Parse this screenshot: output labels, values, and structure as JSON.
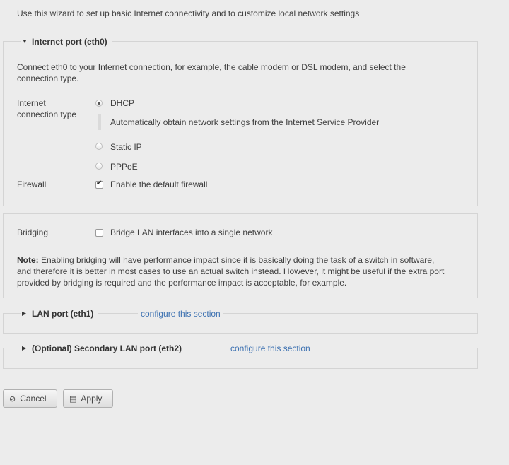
{
  "intro": "Use this wizard to set up basic Internet connectivity and to customize local network settings",
  "internet": {
    "legend": "Internet port (eth0)",
    "description_line1": "Connect eth0 to your Internet connection, for example, the cable modem or DSL modem, and select the",
    "description_line2": "connection type.",
    "conn_label_line1": "Internet",
    "conn_label_line2": "connection type",
    "options": [
      {
        "label": "DHCP",
        "checked": true
      },
      {
        "label": "Static IP",
        "checked": false
      },
      {
        "label": "PPPoE",
        "checked": false
      }
    ],
    "dhcp_hint": "Automatically obtain network settings from the Internet Service Provider",
    "firewall_label": "Firewall",
    "firewall_option": "Enable the default firewall",
    "firewall_checked": true
  },
  "bridging": {
    "label": "Bridging",
    "option": "Bridge LAN interfaces into a single network",
    "checked": false,
    "note_label": "Note:",
    "note_line1": " Enabling bridging will have performance impact since it is basically doing the task of a switch in software,",
    "note_line2": "and therefore it is better in most cases to use an actual switch instead. However, it might be useful if the extra port",
    "note_line3": "provided by bridging is required and the performance impact is acceptable, for example."
  },
  "lan": {
    "legend": "LAN port (eth1)",
    "configure": "configure this section"
  },
  "secondary_lan": {
    "legend": "(Optional) Secondary LAN port (eth2)",
    "configure": "configure this section"
  },
  "buttons": {
    "cancel": "Cancel",
    "apply": "Apply"
  },
  "icons": {
    "expanded": "caret-down-icon",
    "collapsed": "caret-right-icon",
    "cancel": "cancel-icon",
    "apply": "save-icon"
  }
}
